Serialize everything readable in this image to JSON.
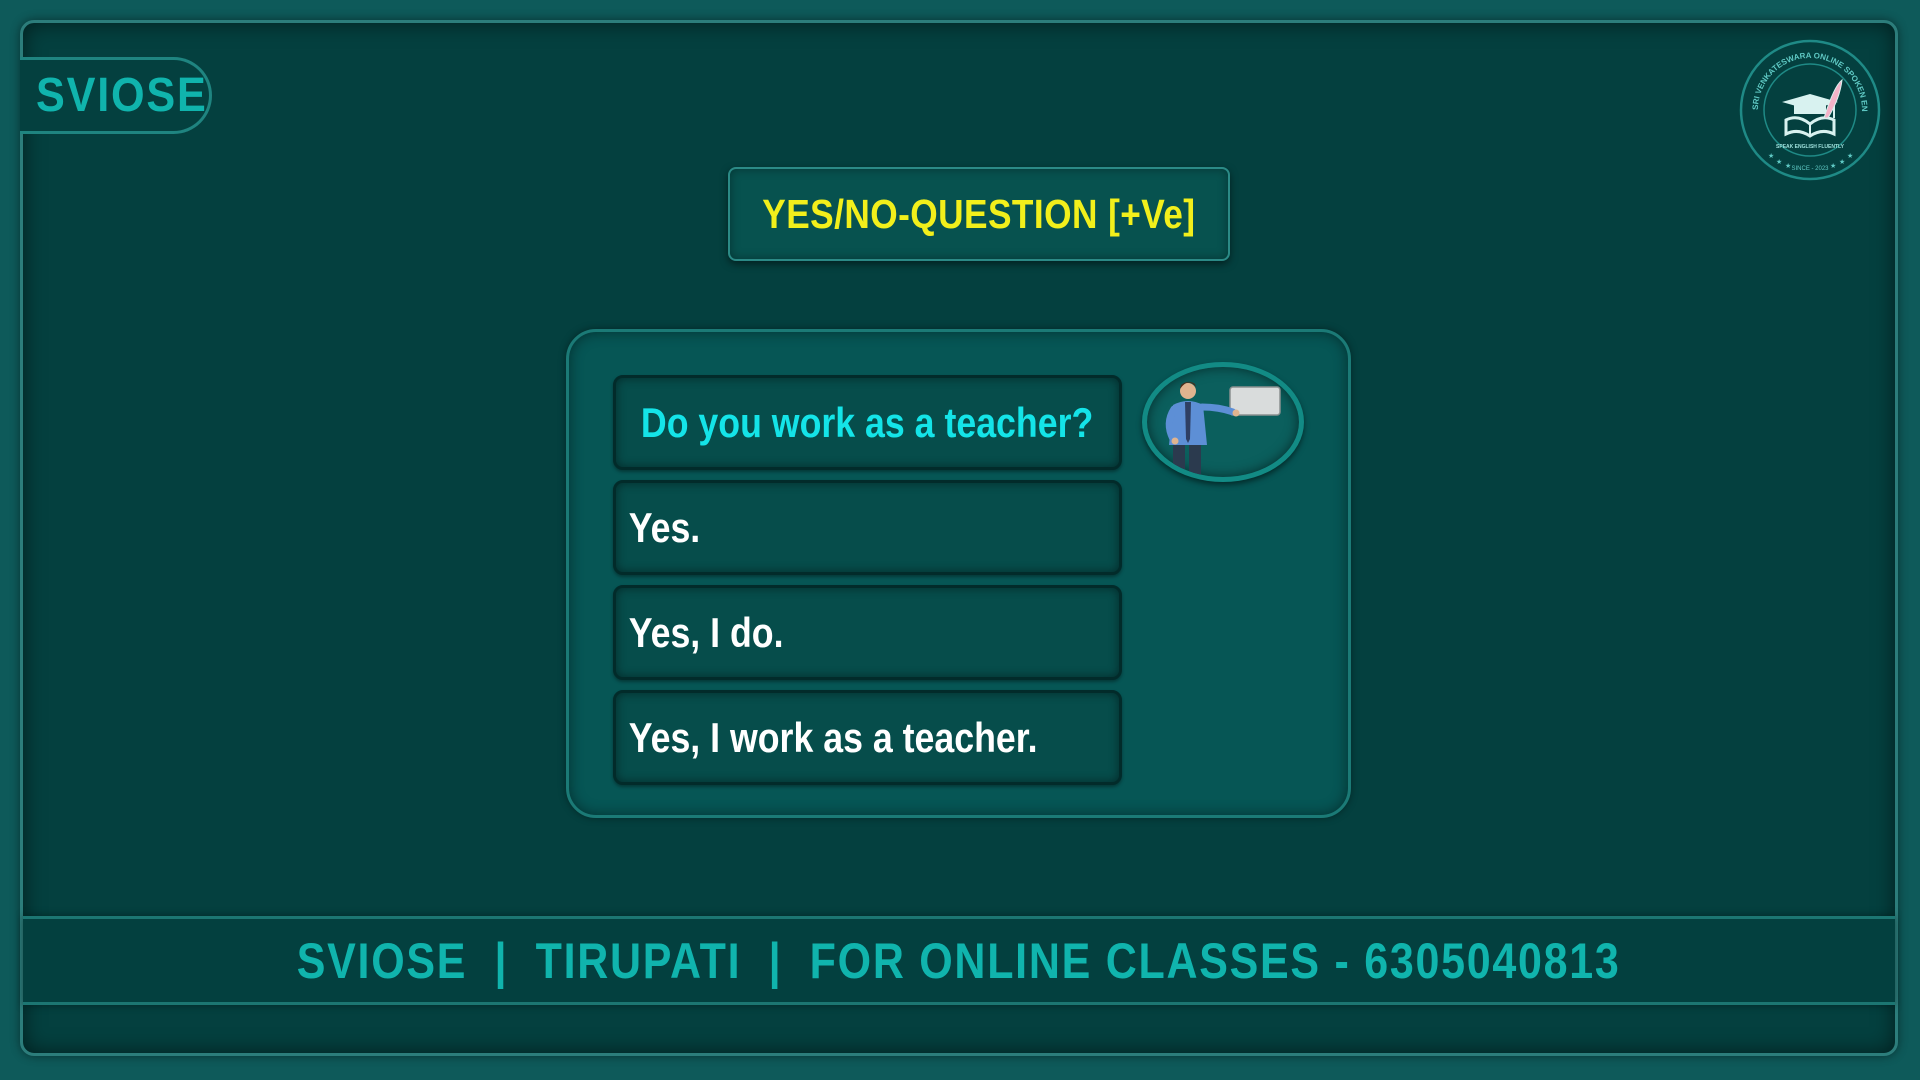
{
  "brand": {
    "label": "SVIOSE"
  },
  "logo": {
    "ring_text_top": "SRI VENKATESWARA ONLINE SPOKEN ENGLISH SCHOOL",
    "banner_text": "SPEAK ENGLISH FLUENTLY",
    "since_text": "SINCE - 2023",
    "icon": "open-book-graduation-cap-quill-icon"
  },
  "title": {
    "text": "YES/NO-QUESTION [+Ve]"
  },
  "panel": {
    "question": "Do you work as a teacher?",
    "answers": [
      "Yes.",
      "Yes, I do.",
      "Yes, I work as a teacher."
    ],
    "illustration": "teacher-pointing-at-board-icon"
  },
  "footer": {
    "text": "SVIOSE  |  TIRUPATI  |  FOR ONLINE CLASSES - 6305040813"
  },
  "colors": {
    "background": "#04403f",
    "accent": "#10b4ad",
    "title": "#f2ef1b",
    "question": "#14e4e8",
    "answer": "#ffffff"
  }
}
